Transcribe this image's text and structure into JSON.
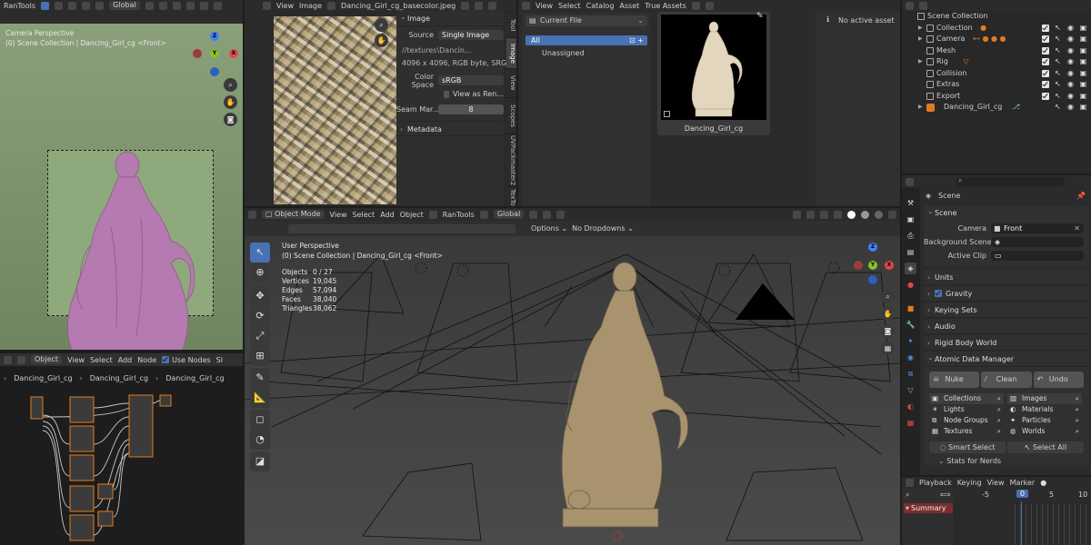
{
  "colors": {
    "accent": "#4772b3",
    "statue_pink": "#b57ab0",
    "camera_bg": "#7b8f6a",
    "viewport_bg": "#3d3d3d",
    "selection_orange": "#e07b22",
    "summary_red": "#7a2d2d"
  },
  "camera_view": {
    "header": {
      "menu": "RanTools",
      "transform": "Global"
    },
    "overlay_line1": "Camera Perspective",
    "overlay_line2": "(0) Scene Collection | Dancing_Girl_cg <Front>",
    "gizmo": {
      "x": "X",
      "y": "Y",
      "z": "Z"
    }
  },
  "image_editor": {
    "header": {
      "view": "View",
      "image": "Image",
      "filename": "Dancing_Girl_cg_basecolor.jpeg"
    },
    "panel": {
      "section_image": "Image",
      "source_label": "Source",
      "source_value": "Single Image",
      "path": "//textures\\Dancin...",
      "info": "4096 x 4096,  RGB byte,  SRG...",
      "colorspace_label": "Color Space",
      "colorspace_value": "sRGB",
      "view_as_render": "View as Ren...",
      "seam_label": "Seam Mar...",
      "seam_value": "8",
      "section_metadata": "Metadata"
    },
    "tabs": [
      "Tool",
      "Image",
      "View",
      "Scopes",
      "UVPackmaster2",
      "TexTool"
    ]
  },
  "asset_browser": {
    "header": {
      "view": "View",
      "select": "Select",
      "catalog": "Catalog",
      "asset": "Asset",
      "true_assets": "True Assets"
    },
    "library": "Current File",
    "catalogs": [
      "All",
      "Unassigned"
    ],
    "asset_name": "Dancing_Girl_cg",
    "no_active_asset": "No active asset"
  },
  "outliner": {
    "title": "Scene Collection",
    "rows": [
      {
        "name": "Collection"
      },
      {
        "name": "Camera"
      },
      {
        "name": "Mesh"
      },
      {
        "name": "Rig"
      },
      {
        "name": "Collision"
      },
      {
        "name": "Extras"
      },
      {
        "name": "Export"
      },
      {
        "name": "Dancing_Girl_cg"
      }
    ]
  },
  "properties": {
    "scene_title": "Scene",
    "section_scene": "Scene",
    "camera_label": "Camera",
    "camera_value": "Front",
    "bg_scene_label": "Background Scene",
    "active_clip_label": "Active Clip",
    "sections": [
      "Units",
      "Gravity",
      "Keying Sets",
      "Audio",
      "Rigid Body World",
      "Atomic Data Manager"
    ],
    "atomic": {
      "nuke": "Nuke",
      "clean": "Clean",
      "undo": "Undo",
      "left": [
        "Collections",
        "Lights",
        "Node Groups",
        "Textures"
      ],
      "right": [
        "Images",
        "Materials",
        "Particles",
        "Worlds"
      ],
      "smart_select": "Smart Select",
      "select_all": "Select All",
      "stats": "Stats for Nerds"
    }
  },
  "viewport": {
    "header": {
      "mode": "Object Mode",
      "view": "View",
      "select": "Select",
      "add": "Add",
      "object": "Object",
      "rantools": "RanTools",
      "transform": "Global"
    },
    "header2": {
      "options": "Options",
      "dropdowns": "No Dropdowns"
    },
    "overlay_title": "User Perspective",
    "overlay_collection": "(0) Scene Collection | Dancing_Girl_cg <Front>",
    "stats": [
      {
        "label": "Objects",
        "value": "0 / 27"
      },
      {
        "label": "Vertices",
        "value": "19,045"
      },
      {
        "label": "Edges",
        "value": "57,094"
      },
      {
        "label": "Faces",
        "value": "38,040"
      },
      {
        "label": "Triangles",
        "value": "38,062"
      }
    ],
    "gizmo": {
      "x": "X",
      "y": "Y",
      "z": "Z"
    }
  },
  "node_editor": {
    "header": {
      "object": "Object",
      "view": "View",
      "select": "Select",
      "add": "Add",
      "node": "Node",
      "use_nodes": "Use Nodes",
      "trailing": "Sl"
    },
    "breadcrumb": [
      "Dancing_Girl_cg",
      "Dancing_Girl_cg",
      "Dancing_Girl_cg"
    ]
  },
  "timeline": {
    "header": {
      "playback": "Playback",
      "keying": "Keying",
      "view": "View",
      "marker": "Marker"
    },
    "ruler": [
      "-5",
      "0",
      "5",
      "10"
    ],
    "current_frame": "0",
    "summary": "Summary"
  }
}
